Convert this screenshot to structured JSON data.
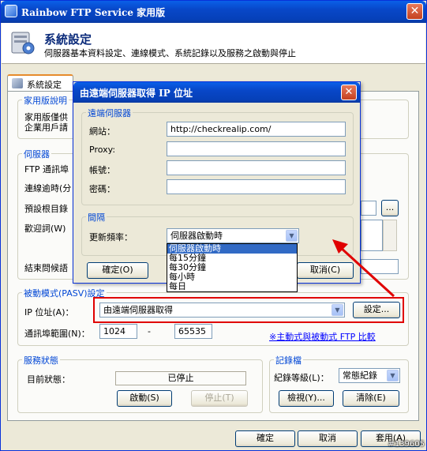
{
  "window": {
    "title": "Rainbow FTP Service 家用版"
  },
  "header": {
    "title": "系統設定",
    "subtitle": "伺服器基本資料設定、連線模式、系統記錄以及服務之啟動與停止"
  },
  "tab": {
    "label": "系統設定"
  },
  "home_group": {
    "label": "家用版說明",
    "line1": "家用版僅供",
    "line2": "企業用戶請"
  },
  "server_group": {
    "label": "伺服器",
    "ftp_port": "FTP 通訊埠",
    "timeout": "連線逾時(分",
    "root": "預設根目錄",
    "welcome": "歡迎詞(W)",
    "goodbye": "結束問候語",
    "browse": "..."
  },
  "pasv_group": {
    "label": "被動模式(PASV)設定",
    "ip_label": "IP 位址(A)：",
    "ip_value": "由遠端伺服器取得",
    "settings_btn": "設定...",
    "port_range_label": "通訊埠範圍(N)：",
    "port_from": "1024",
    "dash": "-",
    "port_to": "65535",
    "compare_link": "※主動式與被動式 FTP 比較"
  },
  "service_group": {
    "label": "服務狀態",
    "status_label": "目前狀態：",
    "status_value": "已停止",
    "start_btn": "啟動(S)",
    "stop_btn": "停止(T)"
  },
  "log_group": {
    "label": "記錄檔",
    "level_label": "紀錄等級(L)：",
    "level_value": "常態紀錄",
    "view_btn": "檢視(Y)...",
    "clear_btn": "清除(E)"
  },
  "footer": {
    "ok": "確定",
    "cancel": "取消",
    "apply": "套用(A)"
  },
  "dialog": {
    "title": "由遠端伺服器取得 IP 位址",
    "remote_group": "遠端伺服器",
    "website_label": "網站：",
    "website_value": "http://checkrealip.com/",
    "proxy_label": "Proxy:",
    "proxy_value": "",
    "account_label": "帳號：",
    "account_value": "",
    "password_label": "密碼：",
    "password_value": "",
    "interval_group": "間隔",
    "freq_label": "更新頻率：",
    "freq_value": "伺服器啟動時",
    "ok": "確定(O)",
    "cancel": "取消(C)",
    "options": [
      "伺服器啟動時",
      "每15分鐘",
      "每30分鐘",
      "每小時",
      "每日"
    ]
  },
  "watermark": "#139605",
  "colors": {
    "highlight_box": "#e00000",
    "arrow": "#e00000",
    "selection": "#316ac5"
  }
}
